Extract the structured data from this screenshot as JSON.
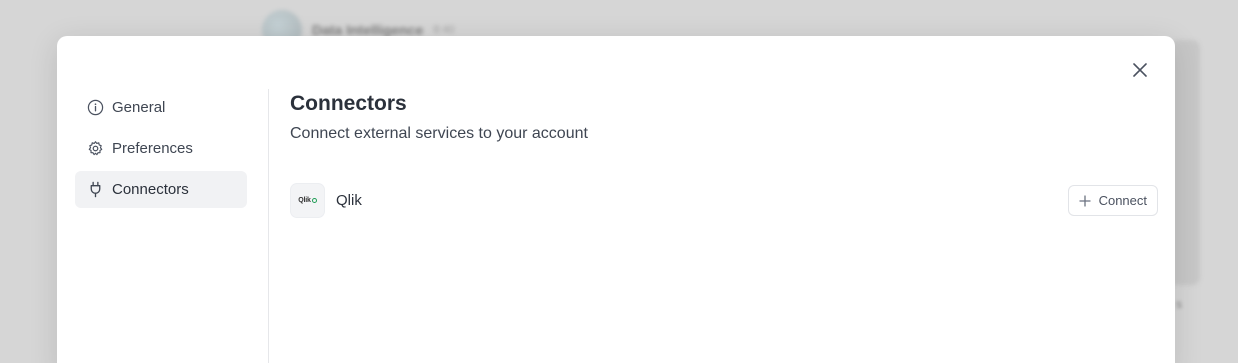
{
  "background": {
    "workspace_title": "Data Intelligence",
    "time": "8:40",
    "footer_text": "s"
  },
  "modal": {
    "close_icon": "close-icon",
    "sidebar": {
      "items": [
        {
          "label": "General",
          "icon": "info-icon",
          "active": false
        },
        {
          "label": "Preferences",
          "icon": "gear-icon",
          "active": false
        },
        {
          "label": "Connectors",
          "icon": "plug-icon",
          "active": true
        }
      ]
    },
    "main": {
      "title": "Connectors",
      "subtitle": "Connect external services to your account",
      "connectors": [
        {
          "logo_text": "Qlik",
          "name": "Qlik",
          "button_label": "Connect",
          "button_icon": "plus-icon"
        }
      ]
    }
  },
  "colors": {
    "overlay": "#d6d6d6",
    "active_nav": "#f1f2f4",
    "qlik_green": "#1f9d55"
  }
}
